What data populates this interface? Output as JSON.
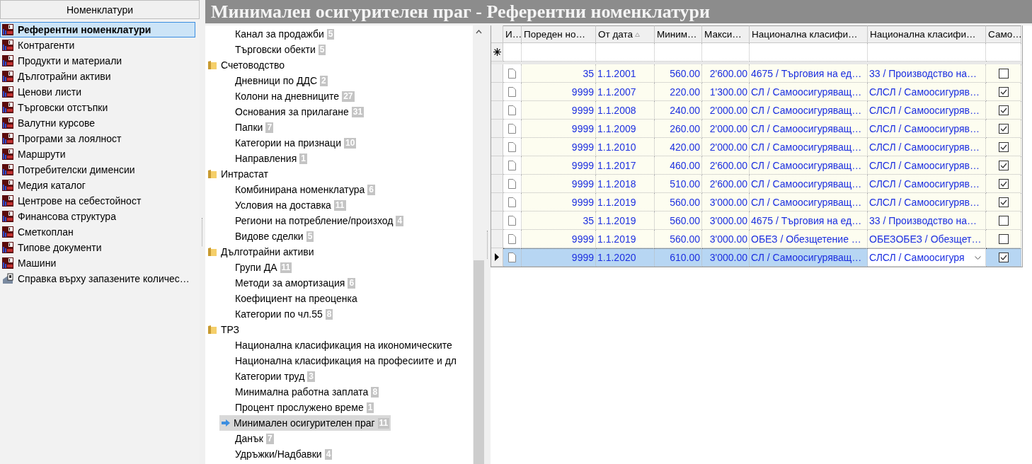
{
  "left_panel": {
    "header": "Номенклатури",
    "items": [
      {
        "label": "Референтни номенклатури",
        "kind": "nomenclature",
        "selected": true
      },
      {
        "label": "Контрагенти",
        "kind": "nomenclature",
        "selected": false
      },
      {
        "label": "Продукти и материали",
        "kind": "nomenclature",
        "selected": false
      },
      {
        "label": "Дълготрайни активи",
        "kind": "nomenclature",
        "selected": false
      },
      {
        "label": "Ценови листи",
        "kind": "nomenclature",
        "selected": false
      },
      {
        "label": "Търговски отстъпки",
        "kind": "nomenclature",
        "selected": false
      },
      {
        "label": "Валутни курсове",
        "kind": "nomenclature",
        "selected": false
      },
      {
        "label": "Програми за лоялност",
        "kind": "nomenclature",
        "selected": false
      },
      {
        "label": "Маршрути",
        "kind": "nomenclature",
        "selected": false
      },
      {
        "label": "Потребителски дименсии",
        "kind": "nomenclature",
        "selected": false
      },
      {
        "label": "Медия каталог",
        "kind": "nomenclature",
        "selected": false
      },
      {
        "label": "Центрове на себестойност",
        "kind": "nomenclature",
        "selected": false
      },
      {
        "label": "Финансова структура",
        "kind": "nomenclature",
        "selected": false
      },
      {
        "label": "Сметкоплан",
        "kind": "nomenclature",
        "selected": false
      },
      {
        "label": "Типове документи",
        "kind": "nomenclature",
        "selected": false
      },
      {
        "label": "Машини",
        "kind": "nomenclature",
        "selected": false
      },
      {
        "label": "Справка върху запазените количес…",
        "kind": "report",
        "selected": false
      }
    ]
  },
  "title": "Минимален осигурителен праг - Референтни номенклатури",
  "tree": {
    "items": [
      {
        "label": "Канал за продажби",
        "count": "5",
        "kind": "leaf",
        "selected": false
      },
      {
        "label": "Търговски обекти",
        "count": "5",
        "kind": "leaf",
        "selected": false
      },
      {
        "label": "Счетоводство",
        "kind": "folder",
        "children": [
          {
            "label": "Дневници по ДДС",
            "count": "2",
            "kind": "leaf",
            "selected": false
          },
          {
            "label": "Колони на дневниците",
            "count": "27",
            "kind": "leaf",
            "selected": false
          },
          {
            "label": "Основания за прилагане",
            "count": "31",
            "kind": "leaf",
            "selected": false
          },
          {
            "label": "Папки",
            "count": "7",
            "kind": "leaf",
            "selected": false
          },
          {
            "label": "Категории на признаци",
            "count": "10",
            "kind": "leaf",
            "selected": false
          },
          {
            "label": "Направления",
            "count": "1",
            "kind": "leaf",
            "selected": false
          }
        ]
      },
      {
        "label": "Интрастат",
        "kind": "folder",
        "children": [
          {
            "label": "Комбинирана номенклатура",
            "count": "6",
            "kind": "leaf",
            "selected": false
          },
          {
            "label": "Условия на доставка",
            "count": "11",
            "kind": "leaf",
            "selected": false
          },
          {
            "label": "Региони на потребление/произход",
            "count": "4",
            "kind": "leaf",
            "selected": false
          },
          {
            "label": "Видове сделки",
            "count": "5",
            "kind": "leaf",
            "selected": false
          }
        ]
      },
      {
        "label": "Дълготрайни активи",
        "kind": "folder",
        "children": [
          {
            "label": "Групи ДА",
            "count": "11",
            "kind": "leaf",
            "selected": false
          },
          {
            "label": "Методи за амортизация",
            "count": "6",
            "kind": "leaf",
            "selected": false
          },
          {
            "label": "Коефициент на преоценка",
            "kind": "leaf",
            "selected": false
          },
          {
            "label": "Категории по чл.55",
            "count": "8",
            "kind": "leaf",
            "selected": false
          }
        ]
      },
      {
        "label": "ТРЗ",
        "kind": "folder",
        "children": [
          {
            "label": "Национална класификация на икономическите",
            "kind": "leaf",
            "selected": false
          },
          {
            "label": "Национална класификация на професиите и дл",
            "kind": "leaf",
            "selected": false
          },
          {
            "label": "Категории труд",
            "count": "3",
            "kind": "leaf",
            "selected": false
          },
          {
            "label": "Минимална работна заплата",
            "count": "8",
            "kind": "leaf",
            "selected": false
          },
          {
            "label": "Процент прослужено време",
            "count": "1",
            "kind": "leaf",
            "selected": false
          },
          {
            "label": "Минимален осигурителен праг",
            "count": "11",
            "kind": "leaf",
            "selected": true
          },
          {
            "label": "Данък",
            "count": "7",
            "kind": "leaf",
            "selected": false
          },
          {
            "label": "Удръжки/Надбавки",
            "count": "4",
            "kind": "leaf",
            "selected": false
          }
        ]
      }
    ]
  },
  "table": {
    "columns": [
      {
        "label": "И…",
        "sorted_ascending": false
      },
      {
        "label": "Пореден но…",
        "sorted_ascending": false
      },
      {
        "label": "От дата",
        "sorted_ascending": true
      },
      {
        "label": "Миним…",
        "sorted_ascending": false
      },
      {
        "label": "Макси…",
        "sorted_ascending": false
      },
      {
        "label": "Национална класифи…",
        "sorted_ascending": false
      },
      {
        "label": "Национална класифи…",
        "sorted_ascending": false
      },
      {
        "label": "Само…",
        "sorted_ascending": false
      }
    ],
    "rows": [
      {
        "number": "35",
        "from_date": "1.1.2001",
        "minimum": "560.00",
        "maximum": "2'600.00",
        "class_1": "4675 / Търговия на ед…",
        "class_2": "33 / Производство на…",
        "self_insured": false,
        "selected": false
      },
      {
        "number": "9999",
        "from_date": "1.1.2007",
        "minimum": "220.00",
        "maximum": "1'300.00",
        "class_1": "СЛ / Самоосигуряващ…",
        "class_2": "СЛСЛ / Самоосигуряв…",
        "self_insured": true,
        "selected": false
      },
      {
        "number": "9999",
        "from_date": "1.1.2008",
        "minimum": "240.00",
        "maximum": "2'000.00",
        "class_1": "СЛ / Самоосигуряващ…",
        "class_2": "СЛСЛ / Самоосигуряв…",
        "self_insured": true,
        "selected": false
      },
      {
        "number": "9999",
        "from_date": "1.1.2009",
        "minimum": "260.00",
        "maximum": "2'000.00",
        "class_1": "СЛ / Самоосигуряващ…",
        "class_2": "СЛСЛ / Самоосигуряв…",
        "self_insured": true,
        "selected": false
      },
      {
        "number": "9999",
        "from_date": "1.1.2010",
        "minimum": "420.00",
        "maximum": "2'000.00",
        "class_1": "СЛ / Самоосигуряващ…",
        "class_2": "СЛСЛ / Самоосигуряв…",
        "self_insured": true,
        "selected": false
      },
      {
        "number": "9999",
        "from_date": "1.1.2017",
        "minimum": "460.00",
        "maximum": "2'600.00",
        "class_1": "СЛ / Самоосигуряващ…",
        "class_2": "СЛСЛ / Самоосигуряв…",
        "self_insured": true,
        "selected": false
      },
      {
        "number": "9999",
        "from_date": "1.1.2018",
        "minimum": "510.00",
        "maximum": "2'600.00",
        "class_1": "СЛ / Самоосигуряващ…",
        "class_2": "СЛСЛ / Самоосигуряв…",
        "self_insured": true,
        "selected": false
      },
      {
        "number": "9999",
        "from_date": "1.1.2019",
        "minimum": "560.00",
        "maximum": "3'000.00",
        "class_1": "СЛ / Самоосигуряващ…",
        "class_2": "СЛСЛ / Самоосигуряв…",
        "self_insured": true,
        "selected": false
      },
      {
        "number": "35",
        "from_date": "1.1.2019",
        "minimum": "560.00",
        "maximum": "3'000.00",
        "class_1": "4675 / Търговия на ед…",
        "class_2": "33 / Производство на…",
        "self_insured": false,
        "selected": false
      },
      {
        "number": "9999",
        "from_date": "1.1.2019",
        "minimum": "560.00",
        "maximum": "3'000.00",
        "class_1": "ОБЕЗ / Обезщетение …",
        "class_2": "ОБЕЗОБЕЗ / Обезщет…",
        "self_insured": false,
        "selected": false
      },
      {
        "number": "9999",
        "from_date": "1.1.2020",
        "minimum": "610.00",
        "maximum": "3'000.00",
        "class_1": "СЛ / Самоосигуряващ…",
        "class_2": "СЛСЛ / Самоосигуря",
        "self_insured": true,
        "selected": true
      }
    ]
  }
}
